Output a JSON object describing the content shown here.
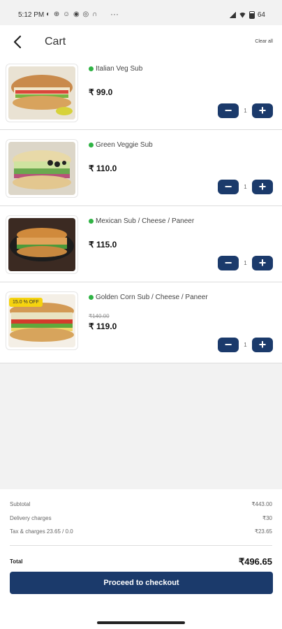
{
  "status_bar": {
    "time": "5:12 PM",
    "more": "···",
    "battery": "64"
  },
  "header": {
    "title": "Cart",
    "clear_all": "Clear all"
  },
  "items": [
    {
      "name": "Italian Veg Sub",
      "price": "₹ 99.0",
      "qty": "1"
    },
    {
      "name": "Green Veggie Sub",
      "price": "₹ 110.0",
      "qty": "1"
    },
    {
      "name": "Mexican Sub / Cheese / Paneer",
      "price": "₹ 115.0",
      "qty": "1"
    },
    {
      "name": "Golden Corn Sub / Cheese / Paneer",
      "old_price": "₹140.00",
      "price": "₹ 119.0",
      "qty": "1",
      "badge": "15.0 % OFF"
    }
  ],
  "summary": {
    "subtotal_label": "Subtotal",
    "subtotal": "₹443.00",
    "delivery_label": "Delivery charges",
    "delivery": "₹30",
    "tax_label": "Tax & charges 23.65 / 0.0",
    "tax": "₹23.65",
    "total_label": "Total",
    "total": "₹496.65",
    "checkout": "Proceed to checkout"
  },
  "colors": {
    "primary": "#1b3a6b",
    "veg": "#2fb344",
    "badge": "#f5d30f"
  },
  "icons": {
    "back": "arrow-left-icon",
    "veg": "veg-dot-icon",
    "minus": "minus-icon",
    "plus": "plus-icon"
  }
}
